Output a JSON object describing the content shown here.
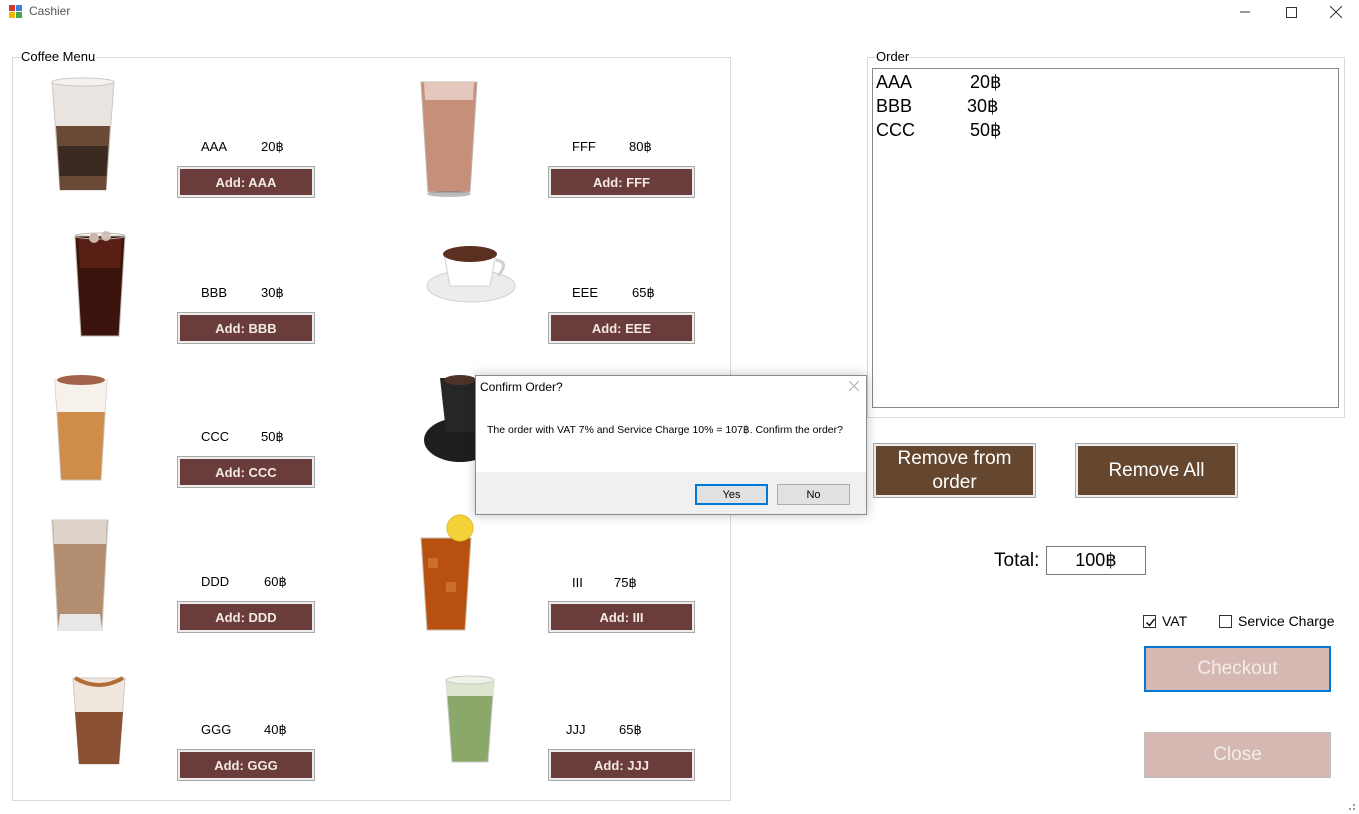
{
  "window": {
    "title": "Cashier"
  },
  "menu": {
    "label": "Coffee Menu",
    "items": [
      {
        "name": "AAA",
        "price": "20฿",
        "button": "Add: AAA"
      },
      {
        "name": "BBB",
        "price": "30฿",
        "button": "Add: BBB"
      },
      {
        "name": "CCC",
        "price": "50฿",
        "button": "Add: CCC"
      },
      {
        "name": "DDD",
        "price": "60฿",
        "button": "Add: DDD"
      },
      {
        "name": "GGG",
        "price": "40฿",
        "button": "Add: GGG"
      },
      {
        "name": "FFF",
        "price": "80฿",
        "button": "Add: FFF"
      },
      {
        "name": "EEE",
        "price": "65฿",
        "button": "Add: EEE"
      },
      {
        "name": "III",
        "price": "75฿",
        "button": "Add: III"
      },
      {
        "name": "JJJ",
        "price": "65฿",
        "button": "Add: JJJ"
      }
    ]
  },
  "order": {
    "label": "Order",
    "rows": [
      {
        "name": "AAA",
        "price": "20฿"
      },
      {
        "name": "BBB",
        "price": "30฿"
      },
      {
        "name": "CCC",
        "price": "50฿"
      }
    ],
    "remove_label": "Remove from order",
    "remove_all_label": "Remove All"
  },
  "total": {
    "label": "Total:",
    "value": "100฿"
  },
  "options": {
    "vat_label": "VAT",
    "vat_checked": true,
    "service_label": "Service Charge",
    "service_checked": false
  },
  "actions": {
    "checkout_label": "Checkout",
    "close_label": "Close"
  },
  "dialog": {
    "title": "Confirm Order?",
    "message": "The order with VAT 7% and Service Charge 10% = 107฿. Confirm the order?",
    "yes_label": "Yes",
    "no_label": "No"
  },
  "colors": {
    "add_button": "#6b3c3c",
    "order_button": "#65472f",
    "disabled_button": "#d6b8b3",
    "accent": "#0078d7"
  }
}
